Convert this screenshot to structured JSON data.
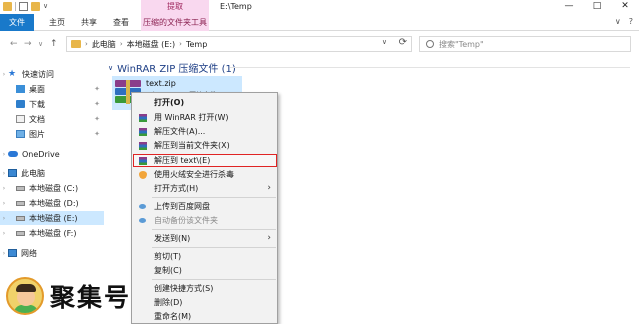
{
  "titlebar": {
    "context_tab_header": "提取",
    "window_title": "E:\\Temp",
    "minimize_glyph": "—",
    "maximize_glyph": "□",
    "close_glyph": "✕"
  },
  "ribbon": {
    "tabs": [
      "文件",
      "主页",
      "共享",
      "查看",
      "压缩的文件夹工具"
    ],
    "collapse_glyph": "∨",
    "help_glyph": "?"
  },
  "addressbar": {
    "back_glyph": "←",
    "forward_glyph": "→",
    "recent_glyph": "∨",
    "up_glyph": "↑",
    "separator_glyph": "›",
    "path": [
      "此电脑",
      "本地磁盘 (E:)",
      "Temp"
    ],
    "dropdown_glyph": "∨",
    "refresh_glyph": "⟳",
    "search_placeholder": "搜索\"Temp\""
  },
  "navpane": {
    "expand_glyph": "›",
    "pin_glyph": "✦",
    "items": [
      {
        "label": "快速访问",
        "icon": "star-icon"
      },
      {
        "label": "桌面",
        "icon": "desktop-icon"
      },
      {
        "label": "下载",
        "icon": "download-icon"
      },
      {
        "label": "文档",
        "icon": "document-icon"
      },
      {
        "label": "图片",
        "icon": "pictures-icon"
      },
      {
        "label": "OneDrive",
        "icon": "onedrive-icon"
      },
      {
        "label": "此电脑",
        "icon": "this-pc-icon"
      },
      {
        "label": "本地磁盘 (C:)",
        "icon": "drive-icon"
      },
      {
        "label": "本地磁盘 (D:)",
        "icon": "drive-icon"
      },
      {
        "label": "本地磁盘 (E:)",
        "icon": "drive-icon",
        "selected": true
      },
      {
        "label": "本地磁盘 (F:)",
        "icon": "drive-icon"
      },
      {
        "label": "网络",
        "icon": "network-icon"
      }
    ]
  },
  "content": {
    "collapse_glyph": "∨",
    "group_header": "WinRAR ZIP 压缩文件 (1)",
    "file": {
      "name": "text.zip",
      "type": "WinRAR ZIP 压缩文件"
    }
  },
  "context_menu": {
    "submenu_glyph": "›",
    "items": [
      {
        "label": "打开(O)",
        "bold": true
      },
      {
        "label": "用 WinRAR 打开(W)",
        "icon": "winrar-icon"
      },
      {
        "label": "解压文件(A)...",
        "icon": "winrar-icon"
      },
      {
        "label": "解压到当前文件夹(X)",
        "icon": "winrar-icon"
      },
      {
        "label": "解压到 text\\(E)",
        "icon": "winrar-icon",
        "highlight": true
      },
      {
        "label": "使用火绒安全进行杀毒",
        "icon": "huorong-shield-icon"
      },
      {
        "label": "打开方式(H)",
        "submenu": true
      },
      {
        "label": "上传到百度网盘",
        "icon": "baidu-cloud-icon"
      },
      {
        "label": "自动备份该文件夹",
        "icon": "baidu-cloud-icon",
        "disabled": true
      },
      {
        "label": "发送到(N)",
        "submenu": true
      },
      {
        "label": "剪切(T)"
      },
      {
        "label": "复制(C)"
      },
      {
        "label": "创建快捷方式(S)"
      },
      {
        "label": "删除(D)"
      },
      {
        "label": "重命名(M)"
      }
    ]
  },
  "watermark": {
    "text": "聚集号"
  },
  "colors": {
    "file_tab": "#1979ca",
    "context_tab": "#f9d8ef",
    "selection": "#cce8ff",
    "highlight_outline": "#e02424",
    "group_header": "#1e3f86"
  }
}
